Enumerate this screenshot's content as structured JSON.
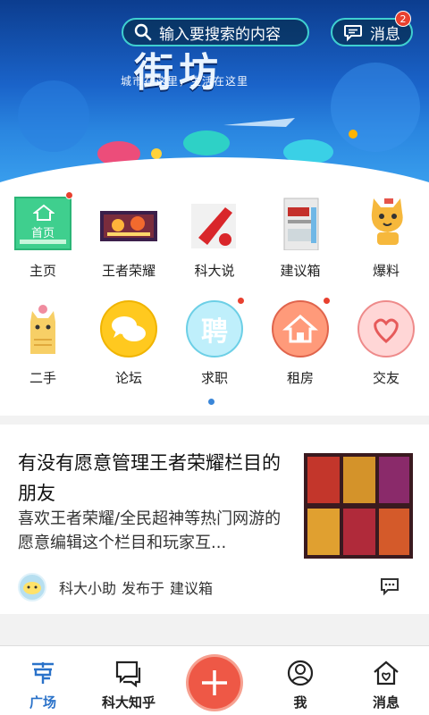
{
  "header": {
    "search_placeholder": "输入要搜索的内容",
    "messages_label": "消息",
    "messages_badge": "2"
  },
  "banner": {
    "title": "街坊",
    "subtitle": "城市在这里，生活在这里"
  },
  "grid": {
    "items": [
      {
        "label": "主页",
        "icon": "home-icon",
        "tile_text": "首页",
        "badge": true
      },
      {
        "label": "王者荣耀",
        "icon": "game-icon",
        "badge": false
      },
      {
        "label": "科大说",
        "icon": "megaphone-icon",
        "badge": false
      },
      {
        "label": "建议箱",
        "icon": "suggestion-box-icon",
        "badge": false
      },
      {
        "label": "爆料",
        "icon": "cat-icon",
        "badge": false
      },
      {
        "label": "二手",
        "icon": "cat-flower-icon",
        "badge": false
      },
      {
        "label": "论坛",
        "icon": "chat-bubbles-icon",
        "badge": false
      },
      {
        "label": "求职",
        "icon": "hire-icon",
        "badge": true,
        "glyph": "聘"
      },
      {
        "label": "租房",
        "icon": "house-icon",
        "badge": true
      },
      {
        "label": "交友",
        "icon": "friends-icon",
        "badge": false
      }
    ],
    "page_indicator": {
      "pages": 1,
      "current": 1
    }
  },
  "post": {
    "title": "有没有愿意管理王者荣耀栏目的朋友",
    "excerpt": "喜欢王者荣耀/全民超神等热门网游的愿意编辑这个栏目和玩家互...",
    "author": "科大小助",
    "published_in_label": "发布于",
    "category": "建议箱"
  },
  "tabbar": {
    "tabs": [
      {
        "label": "广场",
        "icon": "plaza-icon",
        "active": true
      },
      {
        "label": "科大知乎",
        "icon": "qa-icon",
        "active": false
      },
      {
        "label": "",
        "icon": "plus-icon",
        "active": false
      },
      {
        "label": "我",
        "icon": "user-icon",
        "active": false
      },
      {
        "label": "消息",
        "icon": "heart-house-icon",
        "active": false
      }
    ]
  },
  "colors": {
    "accent": "#2a72c9",
    "badge": "#e8402f",
    "plus_button": "#ee5846",
    "search_border": "#3fd0d0"
  }
}
